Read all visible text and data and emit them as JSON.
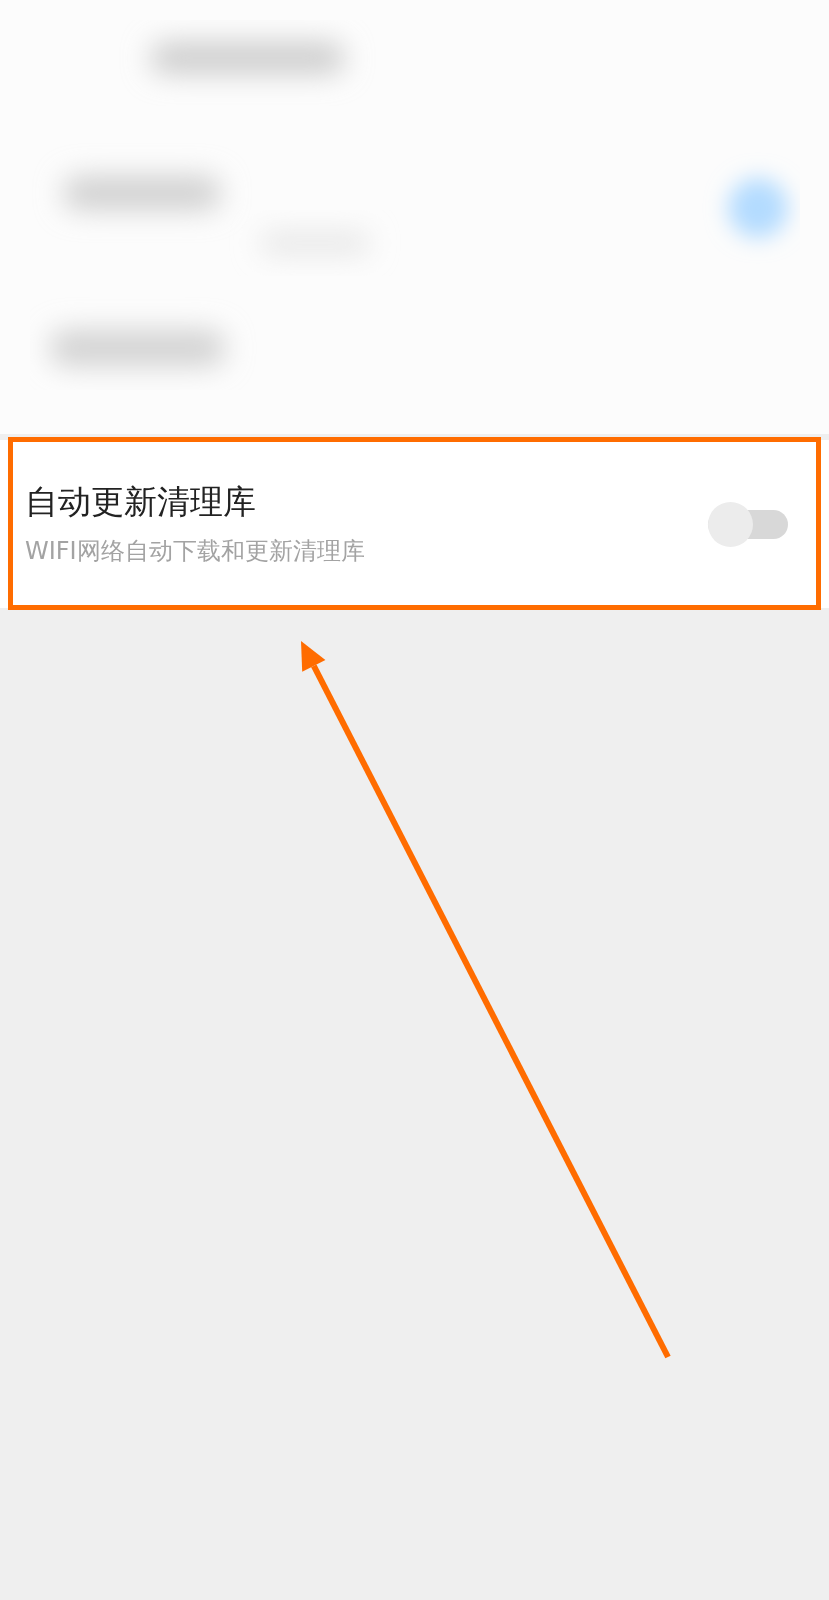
{
  "settings": [
    {
      "title": "自动更新清理库",
      "description": "WIFI网络自动下载和更新清理库",
      "on": false,
      "highlighted": true
    }
  ],
  "annotations": [
    {
      "kind": "arrow"
    }
  ]
}
